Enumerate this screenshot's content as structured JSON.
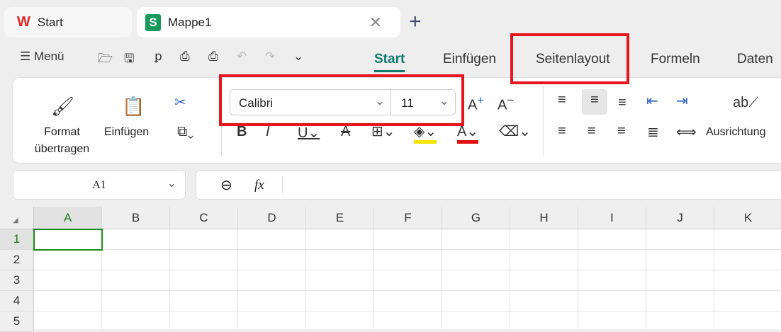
{
  "tabs": [
    {
      "label": "Start",
      "icon": "wps-logo-icon"
    },
    {
      "label": "Mappe1",
      "icon": "spreadsheet-icon"
    }
  ],
  "quick_toolbar": {
    "menu_label": "Menü"
  },
  "menu_tabs": [
    "Start",
    "Einfügen",
    "Seitenlayout",
    "Formeln",
    "Daten"
  ],
  "ribbon": {
    "format_painter": "Format übertragen",
    "paste": "Einfügen",
    "font_name": "Calibri",
    "font_size": "11",
    "alignment": "Ausrichtung"
  },
  "formula_bar": {
    "cell_ref": "A1",
    "fx": "fx",
    "value": ""
  },
  "columns": [
    "A",
    "B",
    "C",
    "D",
    "E",
    "F",
    "G",
    "H",
    "I",
    "J",
    "K"
  ],
  "rows": [
    "1",
    "2",
    "3",
    "4",
    "5"
  ],
  "colors": {
    "accent": "#0e7a6d",
    "annotation": "#e5161f"
  }
}
